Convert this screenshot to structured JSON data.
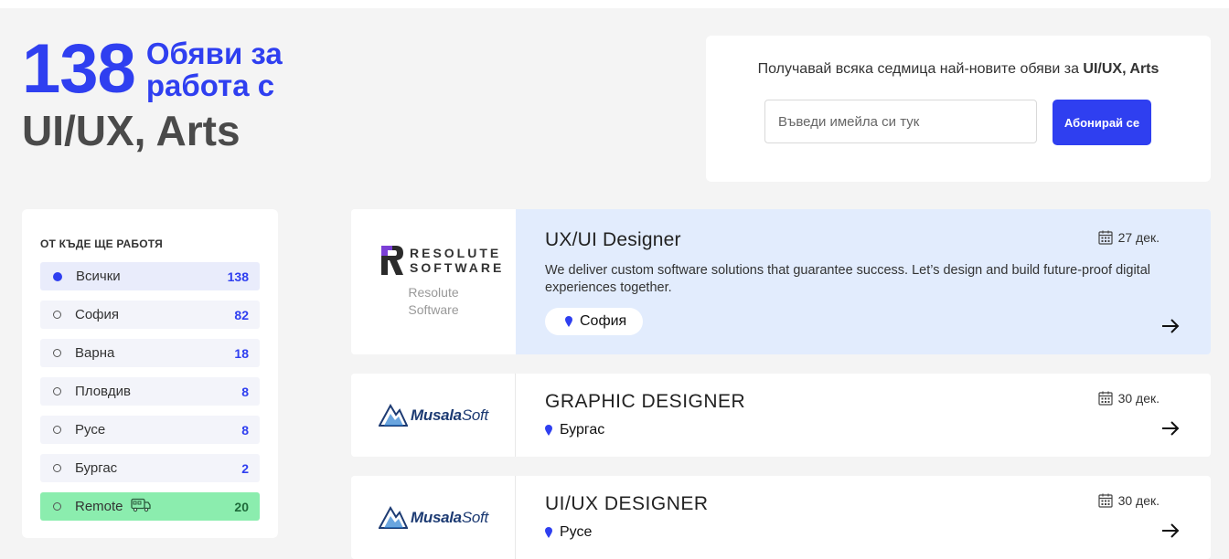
{
  "headline": {
    "count": "138",
    "text_line1": "Обяви за",
    "text_line2": "работа с",
    "category": "UI/UX, Arts"
  },
  "subscribe": {
    "text": "Получавай всяка седмица най-новите обяви за",
    "category": "UI/UX, Arts",
    "input_placeholder": "Въведи имейла си тук",
    "button_label": "Абонирай се"
  },
  "sidebar": {
    "title": "ОТ КЪДЕ ЩЕ РАБОТЯ",
    "items": [
      {
        "name": "Всички",
        "count": "138",
        "selected": true
      },
      {
        "name": "София",
        "count": "82"
      },
      {
        "name": "Варна",
        "count": "18"
      },
      {
        "name": "Пловдив",
        "count": "8"
      },
      {
        "name": "Русе",
        "count": "8"
      },
      {
        "name": "Бургас",
        "count": "2"
      },
      {
        "name": "Remote",
        "count": "20",
        "icon": "remote-work-icon"
      }
    ]
  },
  "jobs": [
    {
      "company_logo_text": "RESOLUTE SOFTWARE",
      "company_caption_line1": "Resolute",
      "company_caption_line2": "Software",
      "title": "UX/UI Designer",
      "date": "27 дек.",
      "description": "We deliver custom software solutions that guarantee success. Let’s design and build future-proof digital experiences together.",
      "location": "София"
    },
    {
      "company_logo_text": "MusalaSoft",
      "title": "GRAPHIC DESIGNER",
      "date": "30 дек.",
      "location": "Бургас"
    },
    {
      "company_logo_text": "MusalaSoft",
      "title": "UI/UX DESIGNER",
      "date": "30 дек.",
      "location": "Русе"
    }
  ],
  "colors": {
    "accent": "#2f3ff0",
    "highlight": "#e2ecfd",
    "remote": "#8bedae",
    "background": "#f4f4f4"
  }
}
